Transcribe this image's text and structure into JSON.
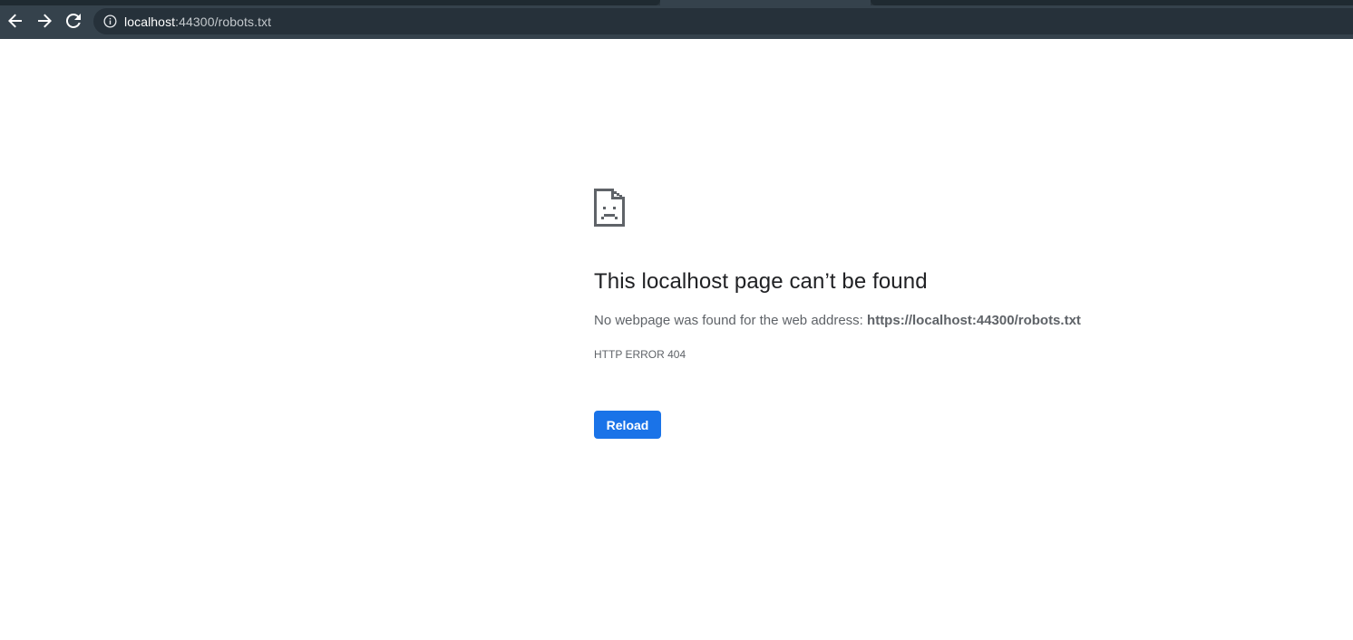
{
  "browser": {
    "nav": {
      "back_icon": "arrow-left-icon",
      "forward_icon": "arrow-right-icon",
      "reload_icon": "reload-icon"
    },
    "omnibox": {
      "security_icon": "info-icon",
      "host": "localhost",
      "path": ":44300/robots.txt"
    },
    "colors": {
      "toolbar": "#35424c",
      "omnibox": "#26313a"
    }
  },
  "error_page": {
    "icon": "sad-document-icon",
    "headline": "This localhost page can’t be found",
    "description_prefix": "No webpage was found for the web address: ",
    "description_url": "https://localhost:44300/robots.txt",
    "error_code": "HTTP ERROR 404",
    "reload_label": "Reload",
    "colors": {
      "button": "#1a73e8",
      "headline": "#202124",
      "text": "#5f6368"
    }
  }
}
